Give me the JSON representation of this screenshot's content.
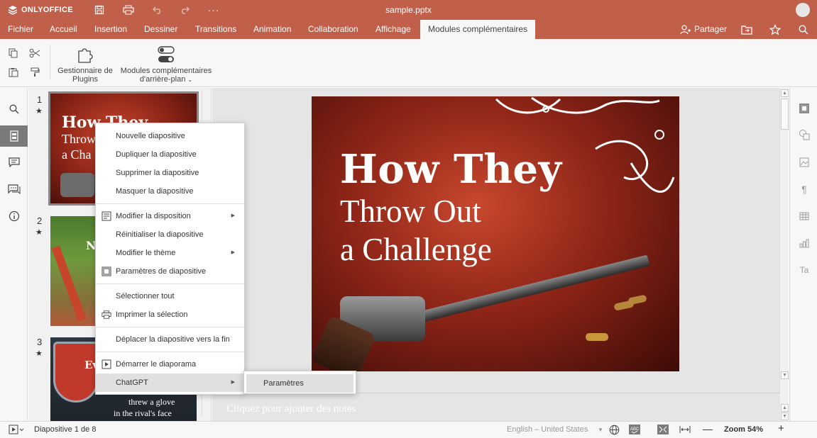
{
  "app": {
    "brand": "ONLYOFFICE",
    "doc_title": "sample.pptx"
  },
  "menu": {
    "tabs": [
      "Fichier",
      "Accueil",
      "Insertion",
      "Dessiner",
      "Transitions",
      "Animation",
      "Collaboration",
      "Affichage",
      "Modules complémentaires"
    ],
    "active_tab": "Modules complémentaires",
    "share_label": "Partager"
  },
  "toolbar": {
    "plugins_manager": "Gestionnaire de Plugins",
    "background_plugins": "Modules complémentaires d'arrière-plan"
  },
  "thumbnails": [
    {
      "number": "1",
      "selected": true
    },
    {
      "number": "2",
      "selected": false
    },
    {
      "number": "3",
      "selected": false
    }
  ],
  "thumb1": {
    "line1": "How They",
    "line2": "Throw",
    "line3": "a Cha"
  },
  "thumb2": {
    "text": "N"
  },
  "thumb3": {
    "text": "Ev",
    "caption1": "threw a glove",
    "caption2": "in the rival's face"
  },
  "slide": {
    "line1": "How They",
    "line2": "Throw Out",
    "line3": "a Challenge"
  },
  "notes_placeholder": "Cliquez pour ajouter des notes",
  "context_menu": {
    "items": [
      "Nouvelle diapositive",
      "Dupliquer la diapositive",
      "Supprimer la diapositive",
      "Masquer la diapositive",
      "Modifier la disposition",
      "Réinitialiser la diapositive",
      "Modifier le thème",
      "Paramètres de diapositive",
      "Sélectionner tout",
      "Imprimer la sélection",
      "Déplacer la diapositive vers la fin",
      "Démarrer le diaporama",
      "ChatGPT"
    ],
    "submenu": [
      "Paramètres"
    ]
  },
  "status": {
    "slide_counter": "Diapositive 1 de 8",
    "language": "English – United States",
    "zoom": "Zoom 54%"
  },
  "colors": {
    "accent": "#c0604a",
    "active_panel": "#7a7a7a"
  }
}
